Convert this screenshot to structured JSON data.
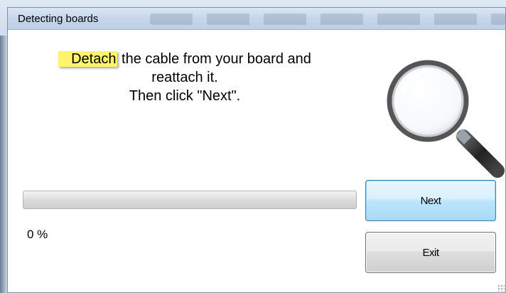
{
  "window": {
    "title": "Detecting boards"
  },
  "instruction": {
    "highlight_word": "Detach",
    "line1_rest": " the cable from your board and",
    "line2": "reattach it.",
    "line3": "Then click \"Next\"."
  },
  "progress": {
    "value_percent": 0,
    "label": "0 %"
  },
  "buttons": {
    "next_label": "Next",
    "exit_label": "Exit"
  },
  "icons": {
    "illustration": "magnifying-glass-icon"
  },
  "colors": {
    "highlight": "#fff46a",
    "next_border": "#3c7fb1"
  }
}
